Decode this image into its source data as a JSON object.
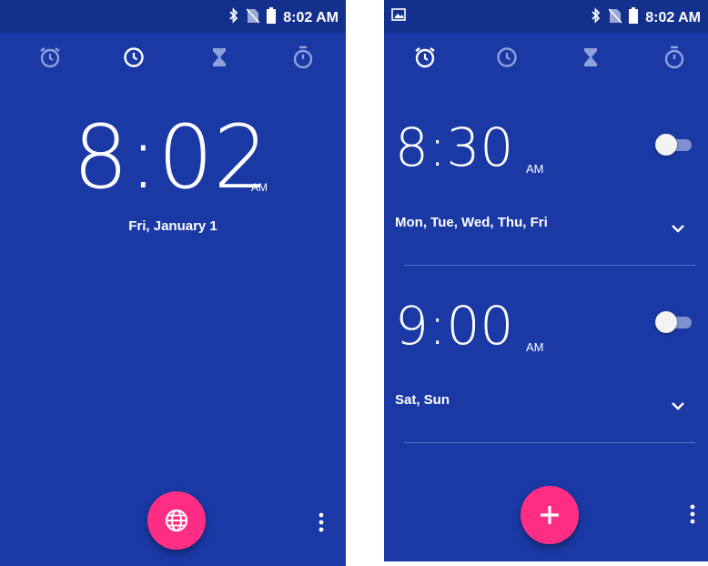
{
  "status": {
    "time": "8:02 AM"
  },
  "tabs": [
    {
      "name": "alarm",
      "icon": "alarm-icon"
    },
    {
      "name": "clock",
      "icon": "clock-icon"
    },
    {
      "name": "timer",
      "icon": "timer-icon"
    },
    {
      "name": "stopwatch",
      "icon": "stopwatch-icon"
    }
  ],
  "clock": {
    "time": "8:02",
    "ampm": "AM",
    "date": "Fri, January 1"
  },
  "alarms": [
    {
      "time": "8:30",
      "ampm": "AM",
      "days": "Mon, Tue, Wed, Thu, Fri",
      "enabled": false
    },
    {
      "time": "9:00",
      "ampm": "AM",
      "days": "Sat, Sun",
      "enabled": false
    }
  ],
  "colors": {
    "background": "#1a39a4",
    "statusbar": "#14308d",
    "fab": "#ff2e84"
  }
}
